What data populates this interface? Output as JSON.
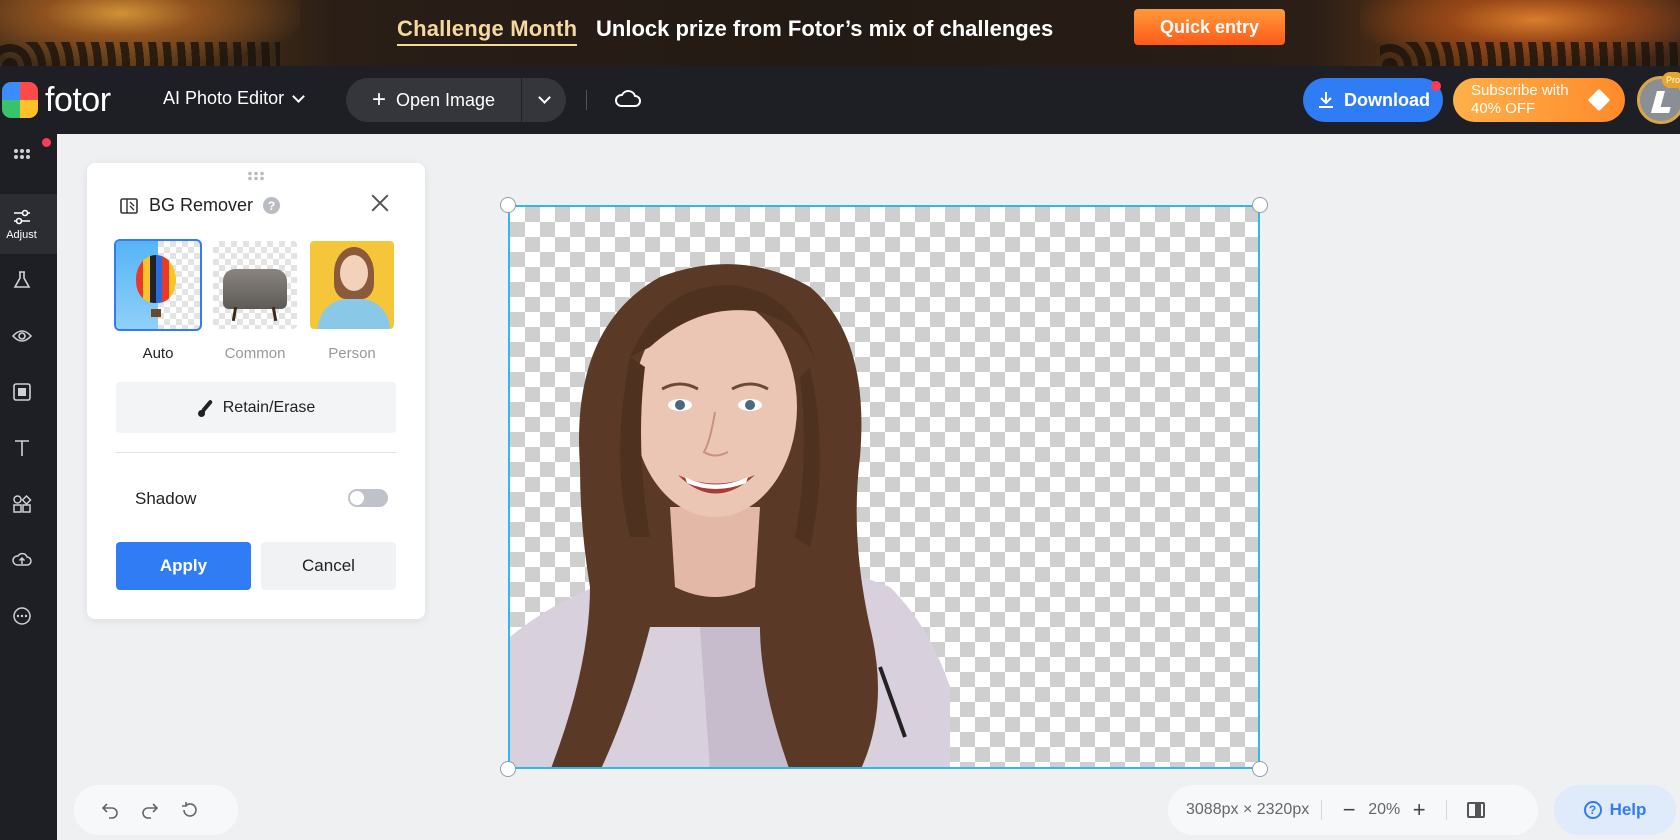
{
  "promo": {
    "title": "Challenge Month",
    "text": "Unlock prize from Fotor’s mix of challenges",
    "button": "Quick entry"
  },
  "topbar": {
    "logo": "fotor",
    "editor_menu": "AI Photo Editor",
    "open_image": "Open Image",
    "download": "Download",
    "subscribe_line1": "Subscribe with",
    "subscribe_line2": "40% OFF",
    "pro_badge": "Pro",
    "accent": "#2f7cf5"
  },
  "rail": {
    "active_label": "Adjust",
    "items": [
      "apps-icon",
      "adjust-icon",
      "beaker-icon",
      "eye-icon",
      "frame-icon",
      "text-icon",
      "elements-icon",
      "upload-cloud-icon",
      "more-icon"
    ]
  },
  "panel": {
    "title": "BG Remover",
    "help": "?",
    "modes": [
      {
        "label": "Auto",
        "selected": true
      },
      {
        "label": "Common",
        "selected": false
      },
      {
        "label": "Person",
        "selected": false
      }
    ],
    "retain_erase": "Retain/Erase",
    "shadow_label": "Shadow",
    "shadow_on": false,
    "apply": "Apply",
    "cancel": "Cancel"
  },
  "canvas": {
    "border_color": "#33b6e8"
  },
  "bottom": {
    "dimensions": "3088px × 2320px",
    "zoom_out": "−",
    "zoom": "20%",
    "zoom_in": "+",
    "help": "Help"
  }
}
